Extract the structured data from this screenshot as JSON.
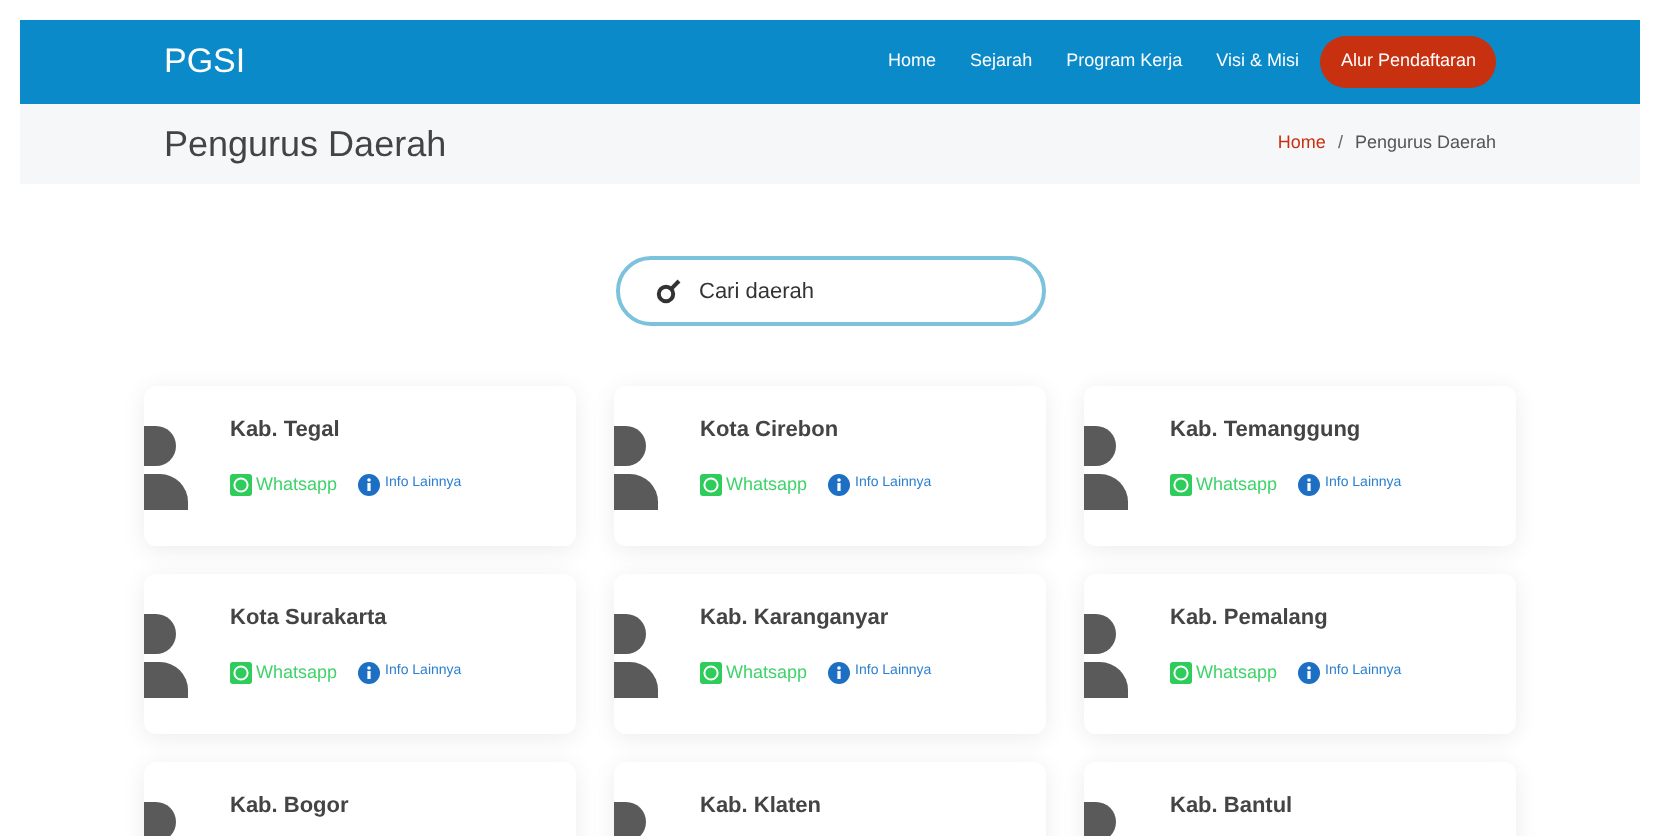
{
  "brand": "PGSI",
  "nav": [
    {
      "label": "Home",
      "kind": "link"
    },
    {
      "label": "Sejarah",
      "kind": "link"
    },
    {
      "label": "Program Kerja",
      "kind": "link"
    },
    {
      "label": "Visi & Misi",
      "kind": "link"
    },
    {
      "label": "Alur Pendaftaran",
      "kind": "cta"
    }
  ],
  "page_title": "Pengurus Daerah",
  "breadcrumb": [
    {
      "label": "Home",
      "kind": "link"
    },
    {
      "label": "/",
      "kind": "separator"
    },
    {
      "label": "Pengurus Daerah",
      "kind": "current"
    }
  ],
  "search": {
    "placeholder": "Cari daerah"
  },
  "cards": [
    {
      "name": "Kab. Tegal",
      "whatsapp": "Whatsapp",
      "info": "Info Lainnya"
    },
    {
      "name": "Kota Cirebon",
      "whatsapp": "Whatsapp",
      "info": "Info Lainnya"
    },
    {
      "name": "Kab. Temanggung",
      "whatsapp": "Whatsapp",
      "info": "Info Lainnya"
    },
    {
      "name": "Kota Surakarta",
      "whatsapp": "Whatsapp",
      "info": "Info Lainnya"
    },
    {
      "name": "Kab. Karanganyar",
      "whatsapp": "Whatsapp",
      "info": "Info Lainnya"
    },
    {
      "name": "Kab. Pemalang",
      "whatsapp": "Whatsapp",
      "info": "Info Lainnya"
    },
    {
      "name": "Kab. Bogor"
    },
    {
      "name": "Kab. Klaten"
    },
    {
      "name": "Kab. Bantul"
    }
  ]
}
